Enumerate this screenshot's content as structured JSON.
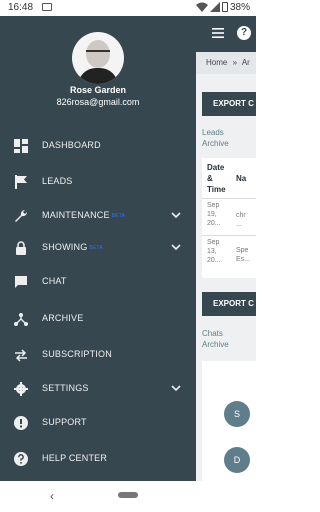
{
  "status_bar": {
    "time": "16:48",
    "battery": "38%"
  },
  "profile": {
    "name": "Rose Garden",
    "email": "826rosa@gmail.com"
  },
  "menu": [
    {
      "label": "DASHBOARD",
      "icon": "dashboard-icon"
    },
    {
      "label": "LEADS",
      "icon": "flag-icon"
    },
    {
      "label": "MAINTENANCE",
      "icon": "wrench-icon",
      "badge": "BETA",
      "expandable": true
    },
    {
      "label": "SHOWING",
      "icon": "lock-icon",
      "badge": "BETA",
      "expandable": true
    },
    {
      "label": "CHAT",
      "icon": "chat-icon"
    },
    {
      "label": "ARCHIVE",
      "icon": "archive-icon"
    },
    {
      "label": "SUBSCRIPTION",
      "icon": "swap-icon"
    },
    {
      "label": "SETTINGS",
      "icon": "gear-icon",
      "expandable": true
    },
    {
      "label": "SUPPORT",
      "icon": "alert-icon"
    },
    {
      "label": "HELP CENTER",
      "icon": "help-icon"
    }
  ],
  "content": {
    "breadcrumb": {
      "home": "Home",
      "sep": "»",
      "current": "Ar"
    },
    "export_label": "EXPORT C",
    "leads_section": {
      "line1": "Leads",
      "line2": "Archive"
    },
    "table": {
      "headers": [
        "Date",
        "&",
        "Time",
        "Na"
      ],
      "rows": [
        {
          "date1": "Sep",
          "date2": "19,",
          "date3": "20...",
          "name1": "chr",
          "name2": "..."
        },
        {
          "date1": "Sep",
          "date2": "13,",
          "date3": "20...",
          "name1": "Spe",
          "name2": "Es..."
        }
      ]
    },
    "chats_section": {
      "line1": "Chats",
      "line2": "Archive"
    },
    "chat_avatars": [
      "S",
      "D"
    ]
  },
  "colors": {
    "drawer": "#37474f",
    "accent": "#607d8b",
    "badge": "#2b6cff"
  }
}
